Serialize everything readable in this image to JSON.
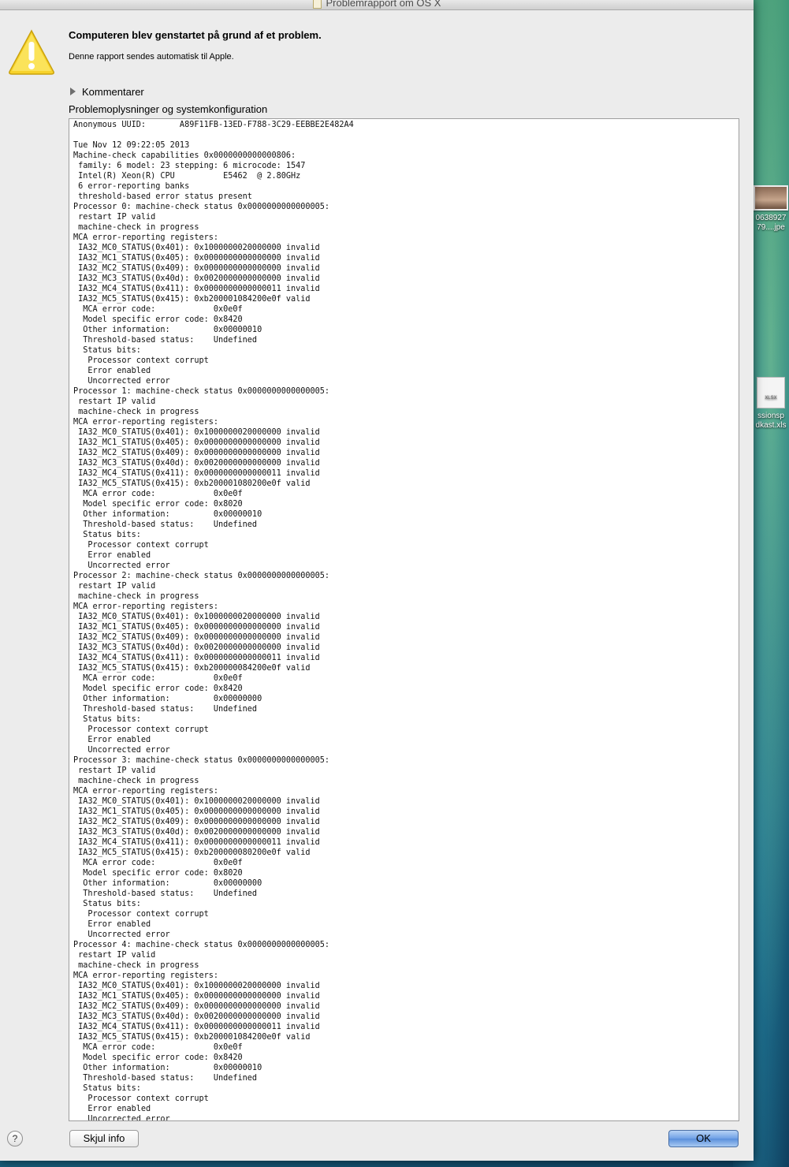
{
  "window": {
    "title": "Problemrapport om OS X"
  },
  "dialog": {
    "headline": "Computeren blev genstartet på grund af et problem.",
    "subline": "Denne rapport sendes automatisk til Apple.",
    "comments_label": "Kommentarer",
    "details_label": "Problemoplysninger og systemkonfiguration",
    "report_text": "Anonymous UUID:       A89F11FB-13ED-F788-3C29-EEBBE2E482A4\n\nTue Nov 12 09:22:05 2013\nMachine-check capabilities 0x0000000000000806:\n family: 6 model: 23 stepping: 6 microcode: 1547\n Intel(R) Xeon(R) CPU          E5462  @ 2.80GHz\n 6 error-reporting banks\n threshold-based error status present\nProcessor 0: machine-check status 0x0000000000000005:\n restart IP valid\n machine-check in progress\nMCA error-reporting registers:\n IA32_MC0_STATUS(0x401): 0x1000000020000000 invalid\n IA32_MC1_STATUS(0x405): 0x0000000000000000 invalid\n IA32_MC2_STATUS(0x409): 0x0000000000000000 invalid\n IA32_MC3_STATUS(0x40d): 0x0020000000000000 invalid\n IA32_MC4_STATUS(0x411): 0x0000000000000011 invalid\n IA32_MC5_STATUS(0x415): 0xb200001084200e0f valid\n  MCA error code:            0x0e0f\n  Model specific error code: 0x8420\n  Other information:         0x00000010\n  Threshold-based status:    Undefined\n  Status bits:\n   Processor context corrupt\n   Error enabled\n   Uncorrected error\nProcessor 1: machine-check status 0x0000000000000005:\n restart IP valid\n machine-check in progress\nMCA error-reporting registers:\n IA32_MC0_STATUS(0x401): 0x1000000020000000 invalid\n IA32_MC1_STATUS(0x405): 0x0000000000000000 invalid\n IA32_MC2_STATUS(0x409): 0x0000000000000000 invalid\n IA32_MC3_STATUS(0x40d): 0x0020000000000000 invalid\n IA32_MC4_STATUS(0x411): 0x0000000000000011 invalid\n IA32_MC5_STATUS(0x415): 0xb200001080200e0f valid\n  MCA error code:            0x0e0f\n  Model specific error code: 0x8020\n  Other information:         0x00000010\n  Threshold-based status:    Undefined\n  Status bits:\n   Processor context corrupt\n   Error enabled\n   Uncorrected error\nProcessor 2: machine-check status 0x0000000000000005:\n restart IP valid\n machine-check in progress\nMCA error-reporting registers:\n IA32_MC0_STATUS(0x401): 0x1000000020000000 invalid\n IA32_MC1_STATUS(0x405): 0x0000000000000000 invalid\n IA32_MC2_STATUS(0x409): 0x0000000000000000 invalid\n IA32_MC3_STATUS(0x40d): 0x0020000000000000 invalid\n IA32_MC4_STATUS(0x411): 0x0000000000000011 invalid\n IA32_MC5_STATUS(0x415): 0xb200000084200e0f valid\n  MCA error code:            0x0e0f\n  Model specific error code: 0x8420\n  Other information:         0x00000000\n  Threshold-based status:    Undefined\n  Status bits:\n   Processor context corrupt\n   Error enabled\n   Uncorrected error\nProcessor 3: machine-check status 0x0000000000000005:\n restart IP valid\n machine-check in progress\nMCA error-reporting registers:\n IA32_MC0_STATUS(0x401): 0x1000000020000000 invalid\n IA32_MC1_STATUS(0x405): 0x0000000000000000 invalid\n IA32_MC2_STATUS(0x409): 0x0000000000000000 invalid\n IA32_MC3_STATUS(0x40d): 0x0020000000000000 invalid\n IA32_MC4_STATUS(0x411): 0x0000000000000011 invalid\n IA32_MC5_STATUS(0x415): 0xb200000080200e0f valid\n  MCA error code:            0x0e0f\n  Model specific error code: 0x8020\n  Other information:         0x00000000\n  Threshold-based status:    Undefined\n  Status bits:\n   Processor context corrupt\n   Error enabled\n   Uncorrected error\nProcessor 4: machine-check status 0x0000000000000005:\n restart IP valid\n machine-check in progress\nMCA error-reporting registers:\n IA32_MC0_STATUS(0x401): 0x1000000020000000 invalid\n IA32_MC1_STATUS(0x405): 0x0000000000000000 invalid\n IA32_MC2_STATUS(0x409): 0x0000000000000000 invalid\n IA32_MC3_STATUS(0x40d): 0x0020000000000000 invalid\n IA32_MC4_STATUS(0x411): 0x0000000000000011 invalid\n IA32_MC5_STATUS(0x415): 0xb200001084200e0f valid\n  MCA error code:            0x0e0f\n  Model specific error code: 0x8420\n  Other information:         0x00000010\n  Threshold-based status:    Undefined\n  Status bits:\n   Processor context corrupt\n   Error enabled\n   Uncorrected error"
  },
  "buttons": {
    "help_label": "?",
    "hide_info_label": "Skjul info",
    "ok_label": "OK"
  },
  "desktop": {
    "icons": [
      {
        "label_line1": "0638927",
        "label_line2": "79....jpe",
        "icon": "image-file-icon"
      },
      {
        "thumb_text": "XLSX",
        "label_line1": "ssionsp",
        "label_line2": "dkast.xls",
        "icon": "xlsx-file-icon"
      }
    ]
  },
  "colors": {
    "warning_yellow": "#f7d22b",
    "ok_button_blue": "#6fa0e6",
    "window_bg": "#ececec"
  }
}
